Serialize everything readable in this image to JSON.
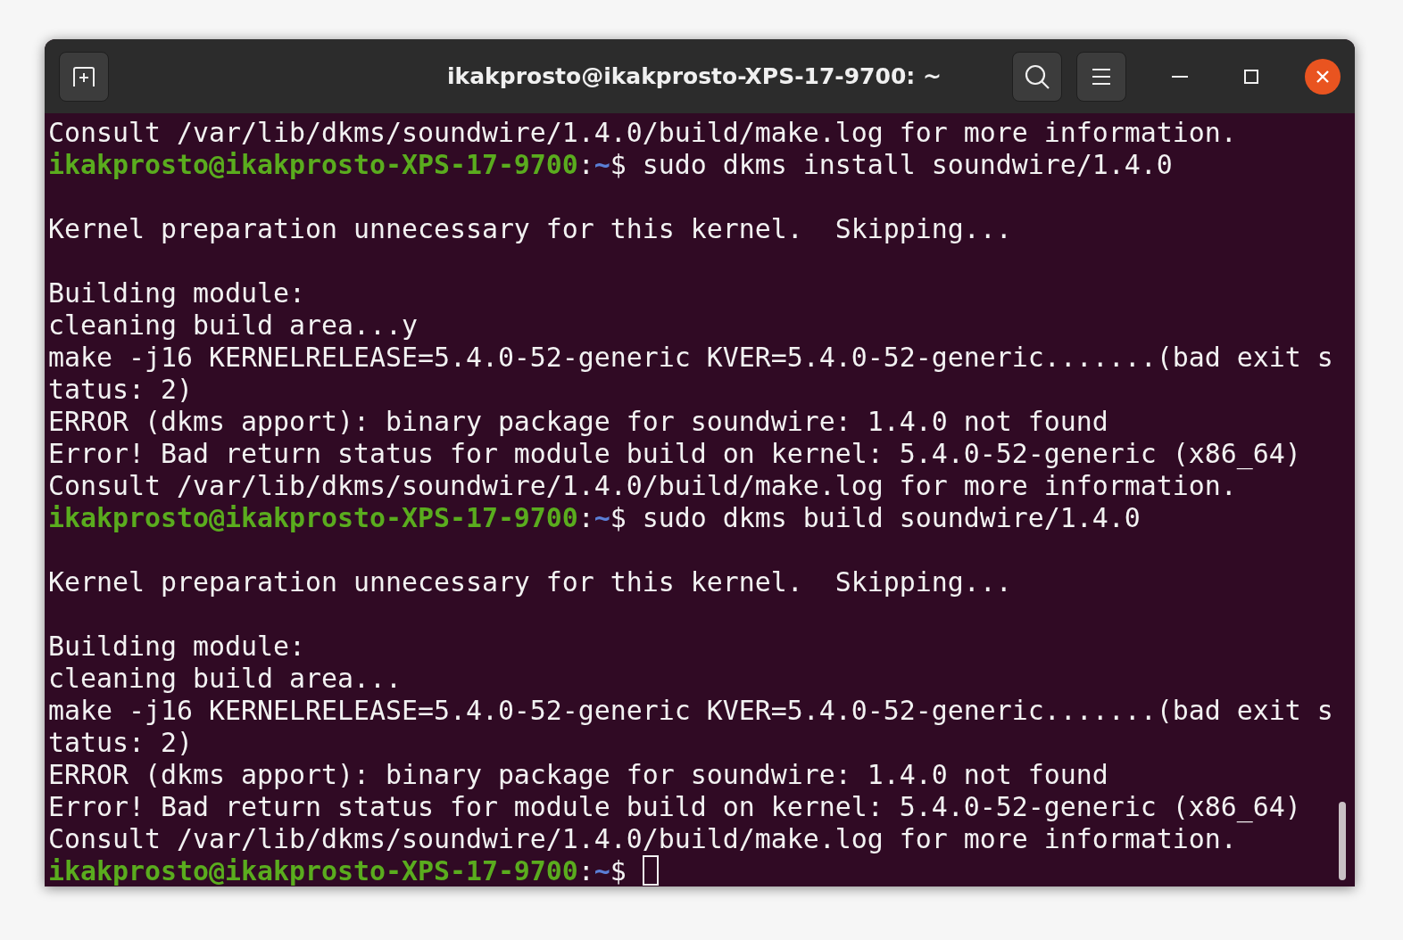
{
  "window": {
    "title": "ikakprosto@ikakprosto-XPS-17-9700: ~"
  },
  "terminal": {
    "lines": [
      {
        "kind": "output",
        "text": "Consult /var/lib/dkms/soundwire/1.4.0/build/make.log for more information."
      },
      {
        "kind": "prompt",
        "user_host": "ikakprosto@ikakprosto-XPS-17-9700",
        "separator": ":",
        "path": "~",
        "symbol": "$",
        "command": "sudo dkms install soundwire/1.4.0",
        "cursor": false
      },
      {
        "kind": "blank"
      },
      {
        "kind": "output",
        "text": "Kernel preparation unnecessary for this kernel.  Skipping..."
      },
      {
        "kind": "blank"
      },
      {
        "kind": "output",
        "text": "Building module:"
      },
      {
        "kind": "output",
        "text": "cleaning build area...y"
      },
      {
        "kind": "output",
        "text": "make -j16 KERNELRELEASE=5.4.0-52-generic KVER=5.4.0-52-generic.......(bad exit s"
      },
      {
        "kind": "output",
        "text": "tatus: 2)"
      },
      {
        "kind": "output",
        "text": "ERROR (dkms apport): binary package for soundwire: 1.4.0 not found"
      },
      {
        "kind": "output",
        "text": "Error! Bad return status for module build on kernel: 5.4.0-52-generic (x86_64)"
      },
      {
        "kind": "output",
        "text": "Consult /var/lib/dkms/soundwire/1.4.0/build/make.log for more information."
      },
      {
        "kind": "prompt",
        "user_host": "ikakprosto@ikakprosto-XPS-17-9700",
        "separator": ":",
        "path": "~",
        "symbol": "$",
        "command": "sudo dkms build soundwire/1.4.0",
        "cursor": false
      },
      {
        "kind": "blank"
      },
      {
        "kind": "output",
        "text": "Kernel preparation unnecessary for this kernel.  Skipping..."
      },
      {
        "kind": "blank"
      },
      {
        "kind": "output",
        "text": "Building module:"
      },
      {
        "kind": "output",
        "text": "cleaning build area..."
      },
      {
        "kind": "output",
        "text": "make -j16 KERNELRELEASE=5.4.0-52-generic KVER=5.4.0-52-generic.......(bad exit s"
      },
      {
        "kind": "output",
        "text": "tatus: 2)"
      },
      {
        "kind": "output",
        "text": "ERROR (dkms apport): binary package for soundwire: 1.4.0 not found"
      },
      {
        "kind": "output",
        "text": "Error! Bad return status for module build on kernel: 5.4.0-52-generic (x86_64)"
      },
      {
        "kind": "output",
        "text": "Consult /var/lib/dkms/soundwire/1.4.0/build/make.log for more information."
      },
      {
        "kind": "prompt",
        "user_host": "ikakprosto@ikakprosto-XPS-17-9700",
        "separator": ":",
        "path": "~",
        "symbol": "$",
        "cursor": true
      }
    ]
  }
}
